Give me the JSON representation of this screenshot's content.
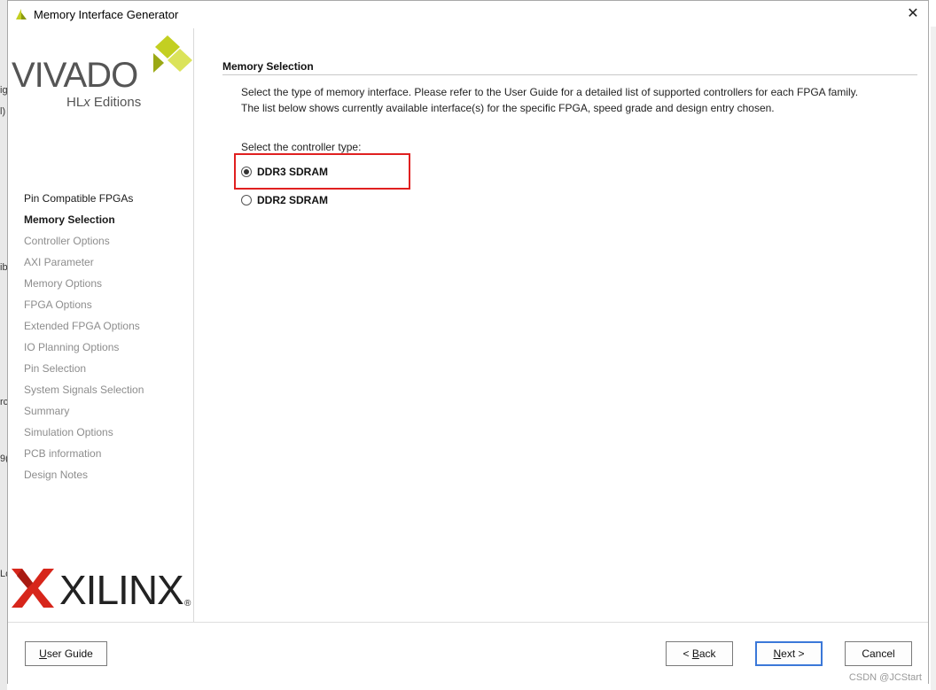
{
  "window": {
    "title": "Memory Interface Generator",
    "close_glyph": "✕"
  },
  "sidebar": {
    "logo_main": "VIVADO",
    "logo_sub_prefix": "HL",
    "logo_sub_x": "x",
    "logo_sub_suffix": " Editions",
    "steps": [
      {
        "label": "Pin Compatible FPGAs",
        "state": "done"
      },
      {
        "label": "Memory Selection",
        "state": "active"
      },
      {
        "label": "Controller Options",
        "state": "pending"
      },
      {
        "label": "AXI Parameter",
        "state": "pending"
      },
      {
        "label": "Memory Options",
        "state": "pending"
      },
      {
        "label": "FPGA Options",
        "state": "pending"
      },
      {
        "label": "Extended FPGA Options",
        "state": "pending"
      },
      {
        "label": "IO Planning Options",
        "state": "pending"
      },
      {
        "label": "Pin Selection",
        "state": "pending"
      },
      {
        "label": "System Signals Selection",
        "state": "pending"
      },
      {
        "label": "Summary",
        "state": "pending"
      },
      {
        "label": "Simulation Options",
        "state": "pending"
      },
      {
        "label": "PCB information",
        "state": "pending"
      },
      {
        "label": "Design Notes",
        "state": "pending"
      }
    ],
    "brand": "XILINX",
    "brand_mark": "®"
  },
  "main": {
    "section_title": "Memory Selection",
    "desc_line1": "Select the type of memory interface. Please refer to the User Guide for a detailed list of supported controllers for each FPGA family.",
    "desc_line2": "The list below shows currently available interface(s) for the specific FPGA, speed grade and design entry chosen.",
    "controller_prompt": "Select the controller type:",
    "options": [
      {
        "label": "DDR3 SDRAM",
        "selected": true
      },
      {
        "label": "DDR2 SDRAM",
        "selected": false
      }
    ]
  },
  "buttons": {
    "user_guide": {
      "mnemonic": "U",
      "rest": "ser Guide"
    },
    "back": {
      "prefix": "< ",
      "mnemonic": "B",
      "rest": "ack"
    },
    "next": {
      "mnemonic": "N",
      "rest": "ext >"
    },
    "cancel": "Cancel"
  },
  "watermark": "CSDN @JCStart",
  "colors": {
    "accent": "#3b78d8",
    "highlight_box": "#e02020",
    "xilinx_red": "#d7261b",
    "vivado_green": "#c3cf21"
  },
  "background_fragments": [
    "ig",
    "l)",
    "ib",
    "rc",
    "9(",
    "Lc"
  ]
}
